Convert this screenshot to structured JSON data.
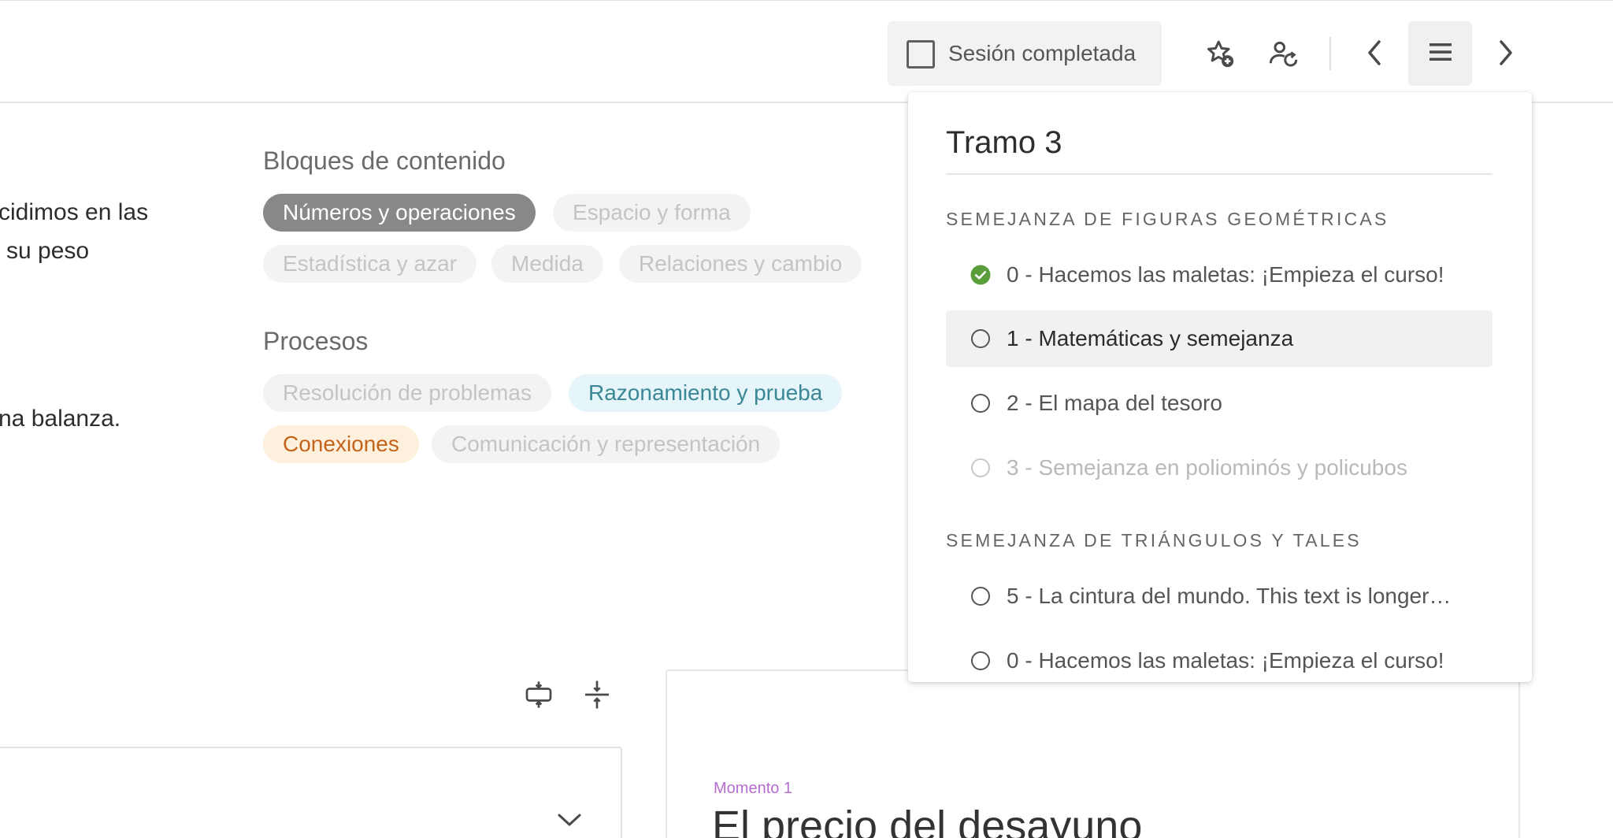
{
  "header": {
    "session_label": "Sesión completada"
  },
  "left_text": {
    "line1": "cidimos en las",
    "line2": "su peso",
    "line3": "na balanza."
  },
  "content_blocks": {
    "title": "Bloques de contenido",
    "tags": [
      {
        "label": "Números y operaciones",
        "state": "active"
      },
      {
        "label": "Espacio y forma",
        "state": "inactive"
      },
      {
        "label": "Estadística y azar",
        "state": "inactive"
      },
      {
        "label": "Medida",
        "state": "inactive"
      },
      {
        "label": "Relaciones y cambio",
        "state": "inactive"
      }
    ]
  },
  "processes": {
    "title": "Procesos",
    "tags": [
      {
        "label": "Resolución de problemas",
        "state": "inactive"
      },
      {
        "label": "Razonamiento y prueba",
        "state": "active"
      },
      {
        "label": "Conexiones",
        "state": "active"
      },
      {
        "label": "Comunicación y representación",
        "state": "inactive"
      }
    ]
  },
  "moment": {
    "label": "Momento 1",
    "title": "El precio del desayuno"
  },
  "panel": {
    "title": "Tramo 3",
    "groups": [
      {
        "title": "SEMEJANZA DE FIGURAS GEOMÉTRICAS",
        "lessons": [
          {
            "label": "0 - Hacemos las maletas: ¡Empieza el curso!",
            "status": "completed"
          },
          {
            "label": "1 - Matemáticas y semejanza",
            "status": "current"
          },
          {
            "label": "2 - El mapa del tesoro",
            "status": "pending"
          },
          {
            "label": "3 - Semejanza en poliominós y policubos",
            "status": "disabled"
          }
        ]
      },
      {
        "title": "SEMEJANZA DE TRIÁNGULOS Y TALES",
        "lessons": [
          {
            "label": "5 - La cintura del mundo. This text is longer…",
            "status": "pending"
          },
          {
            "label": "0 - Hacemos las maletas: ¡Empieza el curso!",
            "status": "pending"
          }
        ]
      }
    ]
  },
  "colors": {
    "completed_check": "#5a9e3c",
    "moment_label": "#b76ed0",
    "tag_active_dark": "#888888",
    "tag_teal_bg": "#e5f5fa",
    "tag_orange_bg": "#fdf0dd"
  },
  "icons": [
    "checkbox-icon",
    "star-add-icon",
    "user-refresh-icon",
    "chevron-left-icon",
    "menu-icon",
    "chevron-right-icon",
    "expand-icon",
    "collapse-icon",
    "chevron-down-icon",
    "check-circle-icon",
    "radio-icon"
  ]
}
